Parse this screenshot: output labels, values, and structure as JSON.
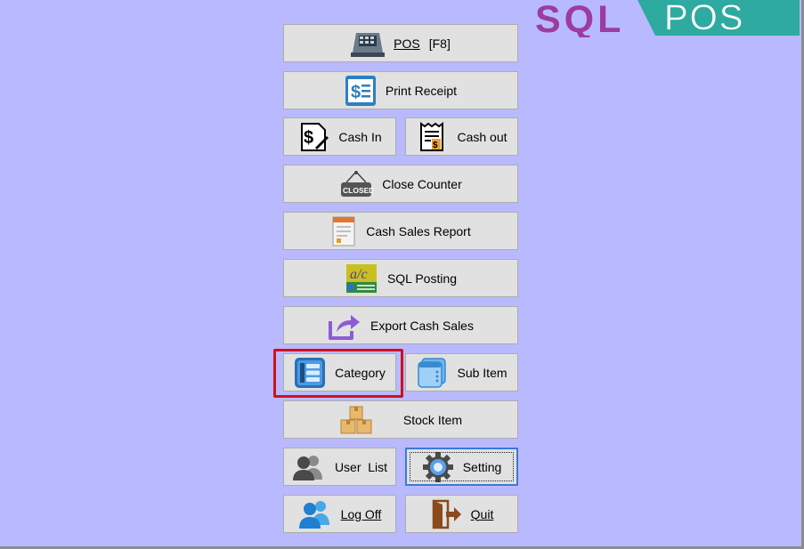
{
  "logo": {
    "left_text": "SQL",
    "right_text": "POS",
    "left_color": "#9a3d9e",
    "right_color": "#2eaaa0"
  },
  "buttons": {
    "pos": {
      "label": "POS",
      "shortcut": "[F8]",
      "icon": "cash-register-icon"
    },
    "print_receipt": {
      "label": "Print Receipt",
      "icon": "receipt-icon"
    },
    "cash_in": {
      "label": "Cash In",
      "icon": "cash-in-icon"
    },
    "cash_out": {
      "label": "Cash out",
      "icon": "cash-out-icon"
    },
    "close_counter": {
      "label": "Close Counter",
      "icon": "closed-sign-icon"
    },
    "cash_sales_report": {
      "label": "Cash Sales Report",
      "icon": "report-icon"
    },
    "sql_posting": {
      "label": "SQL Posting",
      "icon": "posting-icon"
    },
    "export_cash_sales": {
      "label": "Export Cash Sales",
      "icon": "export-icon"
    },
    "category": {
      "label": "Category",
      "icon": "category-icon"
    },
    "sub_item": {
      "label": "Sub Item",
      "icon": "sub-item-icon"
    },
    "stock_item": {
      "label": "Stock Item",
      "icon": "boxes-icon"
    },
    "user_list": {
      "label": "User  List",
      "icon": "users-icon"
    },
    "setting": {
      "label": "Setting",
      "icon": "gear-icon"
    },
    "log_off": {
      "label": "Log Off",
      "icon": "user-logoff-icon"
    },
    "quit": {
      "label": "Quit",
      "icon": "exit-door-icon"
    }
  },
  "colors": {
    "background": "#b9b9ff",
    "button": "#e1e1e1",
    "highlight": "#d0101c"
  }
}
